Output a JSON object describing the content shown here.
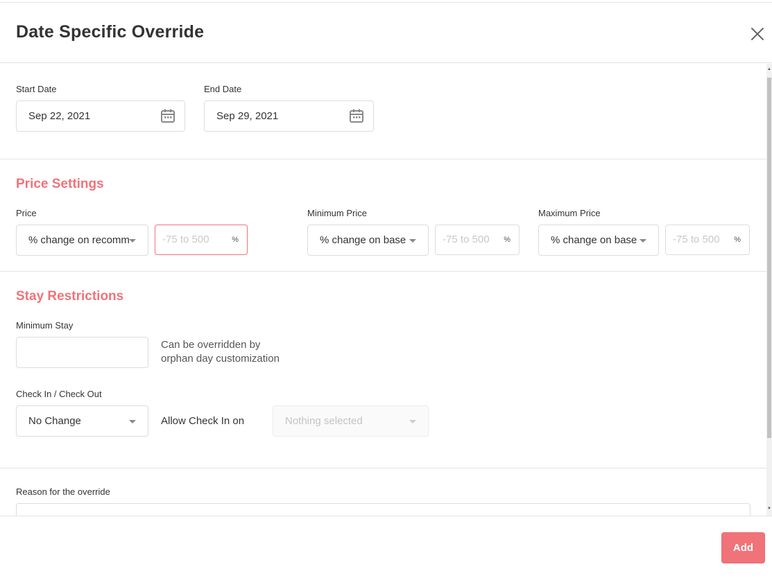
{
  "modal": {
    "title": "Date Specific Override",
    "close_icon": "close-icon"
  },
  "dates": {
    "start_label": "Start Date",
    "start_value": "Sep 22, 2021",
    "end_label": "End Date",
    "end_value": "Sep 29, 2021",
    "calendar_icon": "calendar-icon"
  },
  "price_settings": {
    "title": "Price Settings",
    "price": {
      "label": "Price",
      "select_value": "% change on recommended",
      "input_placeholder": "-75 to 500",
      "unit": "%"
    },
    "min_price": {
      "label": "Minimum Price",
      "select_value": "% change on base",
      "input_placeholder": "-75 to 500",
      "unit": "%"
    },
    "max_price": {
      "label": "Maximum Price",
      "select_value": "% change on base",
      "input_placeholder": "-75 to 500",
      "unit": "%"
    }
  },
  "stay_restrictions": {
    "title": "Stay Restrictions",
    "min_stay_label": "Minimum Stay",
    "min_stay_value": "",
    "min_stay_hint_line1": "Can be overridden by",
    "min_stay_hint_line2": "orphan day customization",
    "checkin_label": "Check In / Check Out",
    "checkin_value": "No Change",
    "allow_checkin_label": "Allow Check In on",
    "allow_checkin_value": "Nothing selected"
  },
  "reason": {
    "label": "Reason for the override",
    "value": ""
  },
  "footer": {
    "add_label": "Add"
  },
  "colors": {
    "accent": "#f07379",
    "border": "#dcdcdc"
  }
}
